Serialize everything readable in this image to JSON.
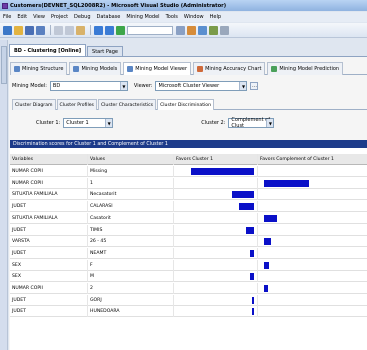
{
  "window": {
    "title": "Customers(DEVNET_SQL2008R2) - Microsoft Visual Studio (Administrator)"
  },
  "menu": [
    "File",
    "Edit",
    "View",
    "Project",
    "Debug",
    "Database",
    "Mining Model",
    "Tools",
    "Window",
    "Help"
  ],
  "doc_tabs": [
    {
      "label": "BD - Clustering [Online]",
      "active": true
    },
    {
      "label": "Start Page",
      "active": false
    }
  ],
  "mining_tabs": [
    {
      "label": "Mining Structure",
      "active": false
    },
    {
      "label": "Mining Models",
      "active": false
    },
    {
      "label": "Mining Model Viewer",
      "active": true
    },
    {
      "label": "Mining Accuracy Chart",
      "active": false
    },
    {
      "label": "Mining Model Prediction",
      "active": false
    }
  ],
  "model_row": {
    "mining_model_label": "Mining Model:",
    "mining_model_value": "BD",
    "viewer_label": "Viewer:",
    "viewer_value": "Microsoft Cluster Viewer"
  },
  "sub_tabs": [
    {
      "label": "Cluster Diagram",
      "active": false
    },
    {
      "label": "Cluster Profiles",
      "active": false
    },
    {
      "label": "Cluster Characteristics",
      "active": false
    },
    {
      "label": "Cluster Discrimination",
      "active": true
    }
  ],
  "cluster_row": {
    "c1_label": "Cluster 1:",
    "c1_value": "Cluster 1",
    "c2_label": "Cluster 2:",
    "c2_value": "Complement of Clust"
  },
  "table_title": "Discrimination scores for Cluster 1 and Complement of Cluster 1",
  "columns": [
    "Variables",
    "Values",
    "Favors Cluster 1",
    "Favors Complement of Cluster 1"
  ],
  "rows": [
    {
      "variable": "NUMAR COPII",
      "value": "Missing",
      "fav1": 0.85,
      "fav2": 0
    },
    {
      "variable": "NUMAR COPII",
      "value": "1",
      "fav1": 0,
      "fav2": 0.45
    },
    {
      "variable": "SITUATIA FAMILIALA",
      "value": "Necasatorit",
      "fav1": 0.3,
      "fav2": 0
    },
    {
      "variable": "JUDET",
      "value": "CALARASI",
      "fav1": 0.2,
      "fav2": 0
    },
    {
      "variable": "SITUATIA FAMILIALA",
      "value": "Casatorit",
      "fav1": 0,
      "fav2": 0.13
    },
    {
      "variable": "JUDET",
      "value": "TIMIS",
      "fav1": 0.11,
      "fav2": 0
    },
    {
      "variable": "VARSTA",
      "value": "26 - 45",
      "fav1": 0,
      "fav2": 0.07
    },
    {
      "variable": "JUDET",
      "value": "NEAMT",
      "fav1": 0.06,
      "fav2": 0
    },
    {
      "variable": "SEX",
      "value": "F",
      "fav1": 0,
      "fav2": 0.05
    },
    {
      "variable": "SEX",
      "value": "M",
      "fav1": 0.05,
      "fav2": 0
    },
    {
      "variable": "NUMAR COPII",
      "value": "2",
      "fav1": 0,
      "fav2": 0.04
    },
    {
      "variable": "JUDET",
      "value": "GORJ",
      "fav1": 0.03,
      "fav2": 0
    },
    {
      "variable": "JUDET",
      "value": "HUNEDOARA",
      "fav1": 0.02,
      "fav2": 0
    }
  ]
}
